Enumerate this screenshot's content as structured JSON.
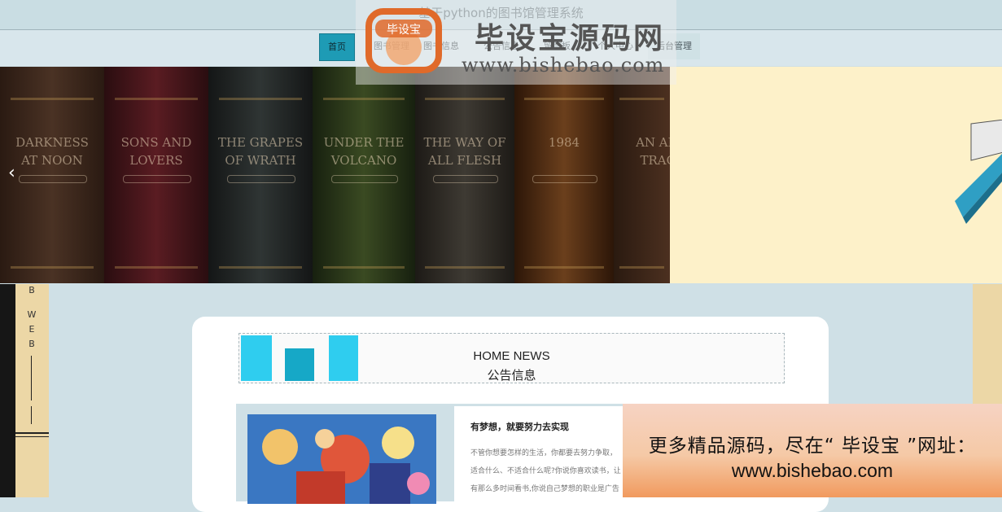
{
  "header": {
    "title": "基于python的图书馆管理系统"
  },
  "nav": {
    "items": [
      {
        "label": "首页",
        "active": true
      },
      {
        "label": "图书管理"
      },
      {
        "label": "图书信息"
      },
      {
        "label": "公告信息"
      },
      {
        "label": "留言板"
      },
      {
        "label": "个人中心"
      },
      {
        "label": "后台管理"
      }
    ]
  },
  "watermark": {
    "name": "毕设宝源码网",
    "url": "www.bishebao.com",
    "logo_text": "毕设宝"
  },
  "hero": {
    "books": [
      "DARKNESS\nAT NOON",
      "SONS AND\nLOVERS",
      "THE GRAPES\nOF WRATH",
      "UNDER THE\nVOLCANO",
      "THE WAY OF\nALL FLESH",
      "1984",
      "AN AME\nTRAGE"
    ],
    "prev_icon": "chevron-left-icon"
  },
  "sidebar_strip": {
    "letters": [
      "B",
      "W",
      "E",
      "B"
    ]
  },
  "news": {
    "heading_en": "HOME NEWS",
    "heading_zh": "公告信息",
    "item": {
      "title": "有梦想，就要努力去实现",
      "lines": [
        "不管你想要怎样的生活，你都要去努力争取，",
        "适合什么、不适合什么呢?你说你喜欢读书，让",
        "有那么多时间看书,你说自己梦想的职业是广告"
      ]
    }
  },
  "ad": {
    "line1": "更多精品源码，尽在“ 毕设宝 ”网址：",
    "line2": "www.bishebao.com"
  },
  "colors": {
    "accent": "#1e9bb5",
    "block": "#2fcdef",
    "page_bg": "#cfe0e6"
  }
}
